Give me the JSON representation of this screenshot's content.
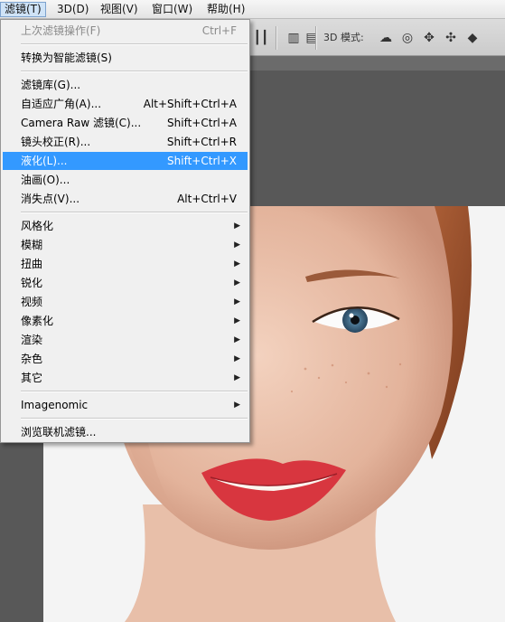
{
  "menubar": {
    "items": [
      "滤镜(T)",
      "3D(D)",
      "视图(V)",
      "窗口(W)",
      "帮助(H)"
    ]
  },
  "optionsbar": {
    "mode_label": "3D 模式:"
  },
  "filter_menu": {
    "last_filter": {
      "label": "上次滤镜操作(F)",
      "shortcut": "Ctrl+F"
    },
    "convert_smart": {
      "label": "转换为智能滤镜(S)"
    },
    "gallery": {
      "label": "滤镜库(G)..."
    },
    "adaptive_wide": {
      "label": "自适应广角(A)...",
      "shortcut": "Alt+Shift+Ctrl+A"
    },
    "camera_raw": {
      "label": "Camera Raw 滤镜(C)...",
      "shortcut": "Shift+Ctrl+A"
    },
    "lens_correction": {
      "label": "镜头校正(R)...",
      "shortcut": "Shift+Ctrl+R"
    },
    "liquify": {
      "label": "液化(L)...",
      "shortcut": "Shift+Ctrl+X"
    },
    "oil_paint": {
      "label": "油画(O)..."
    },
    "vanishing_point": {
      "label": "消失点(V)...",
      "shortcut": "Alt+Ctrl+V"
    },
    "submenus": [
      "风格化",
      "模糊",
      "扭曲",
      "锐化",
      "视频",
      "像素化",
      "渲染",
      "杂色",
      "其它"
    ],
    "imagenomic": {
      "label": "Imagenomic"
    },
    "browse_online": {
      "label": "浏览联机滤镜..."
    }
  },
  "colors": {
    "highlight": "#3399ff",
    "frame": "#e0292b"
  }
}
